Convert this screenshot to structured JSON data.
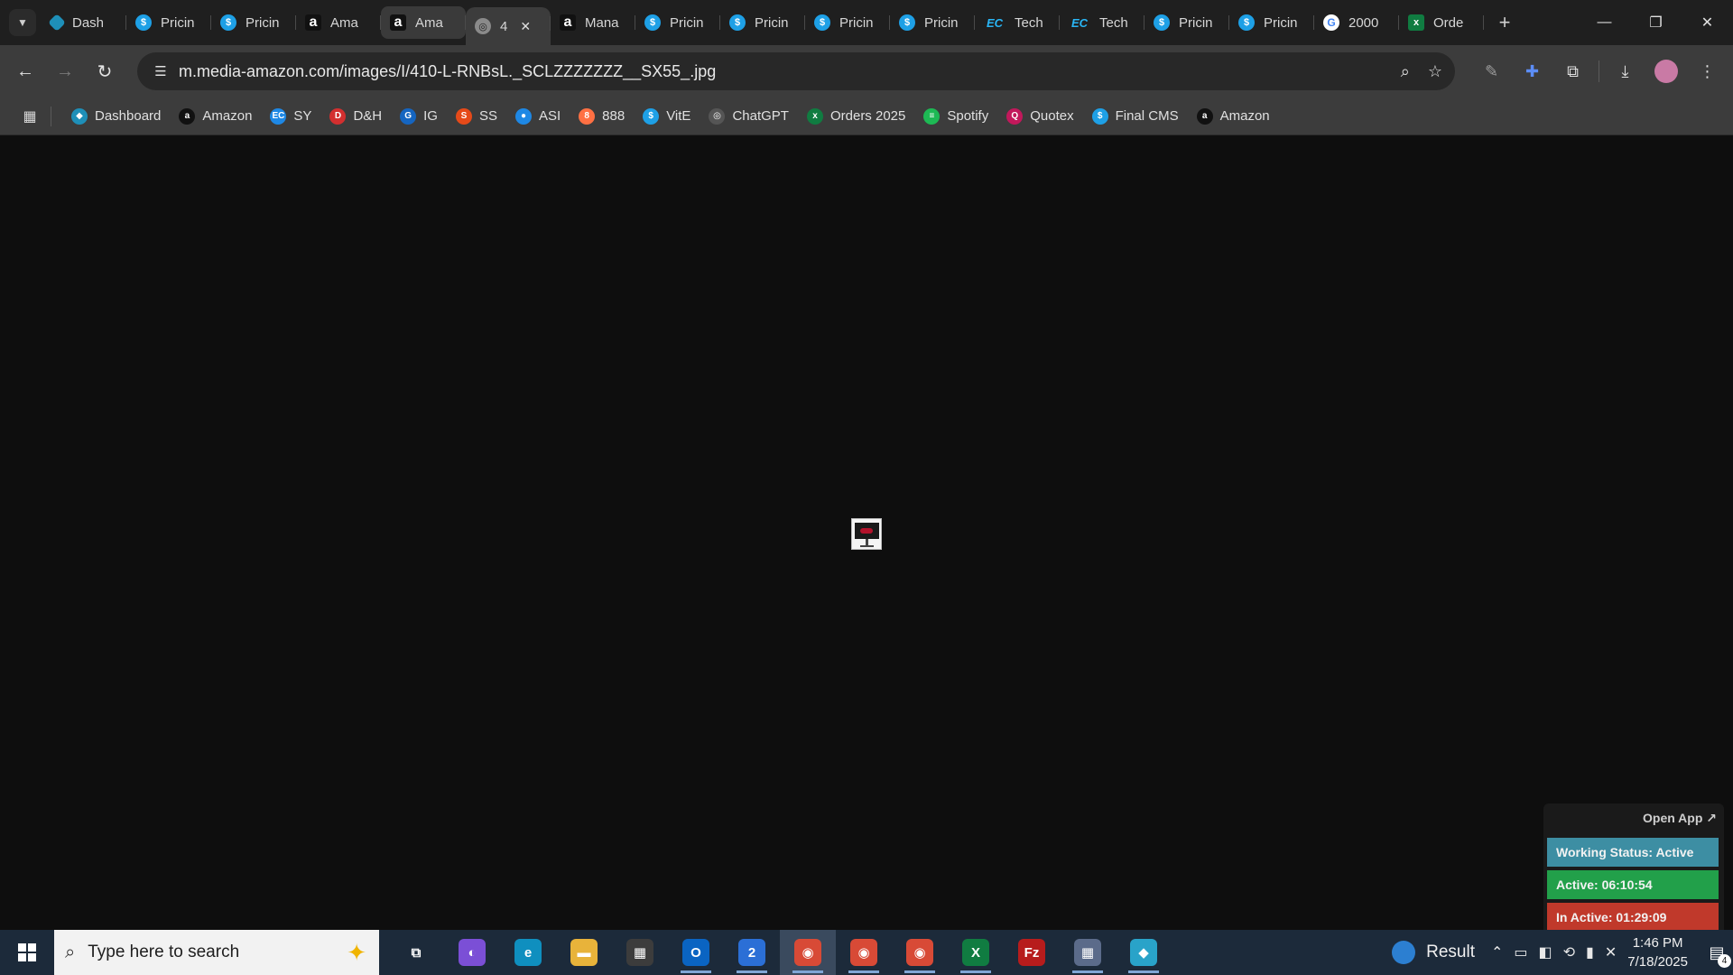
{
  "browser": {
    "tab_search_icon": "chevron-down-icon",
    "tabs": [
      {
        "label": "Dash",
        "icon": "dashboard-icon",
        "kind": "dash"
      },
      {
        "label": "Pricin",
        "icon": "dollar-icon",
        "kind": "dollar"
      },
      {
        "label": "Pricin",
        "icon": "dollar-icon",
        "kind": "dollar"
      },
      {
        "label": "Ama",
        "icon": "amazon-icon",
        "kind": "amazon"
      },
      {
        "label": "Ama",
        "icon": "amazon-icon",
        "kind": "amazon",
        "highlight": true
      },
      {
        "label": "4",
        "icon": "globe-icon",
        "kind": "globe",
        "active": true
      },
      {
        "label": "Mana",
        "icon": "amazon-icon",
        "kind": "amazon"
      },
      {
        "label": "Pricin",
        "icon": "dollar-icon",
        "kind": "dollar"
      },
      {
        "label": "Pricin",
        "icon": "dollar-icon",
        "kind": "dollar"
      },
      {
        "label": "Pricin",
        "icon": "dollar-icon",
        "kind": "dollar"
      },
      {
        "label": "Pricin",
        "icon": "dollar-icon",
        "kind": "dollar"
      },
      {
        "label": "Tech",
        "icon": "ec-icon",
        "kind": "ec"
      },
      {
        "label": "Tech",
        "icon": "ec-icon",
        "kind": "ec"
      },
      {
        "label": "Pricin",
        "icon": "dollar-icon",
        "kind": "dollar"
      },
      {
        "label": "Pricin",
        "icon": "dollar-icon",
        "kind": "dollar"
      },
      {
        "label": "2000",
        "icon": "google-icon",
        "kind": "google"
      },
      {
        "label": "Orde",
        "icon": "excel-icon",
        "kind": "excel"
      }
    ],
    "address": "m.media-amazon.com/images/I/410-L-RNBsL._SCLZZZZZZZ__SX55_.jpg"
  },
  "bookmarks": [
    {
      "label": "Dashboard",
      "color": "#1e8fb8",
      "glyph": "◆"
    },
    {
      "label": "Amazon",
      "color": "#111111",
      "glyph": "a"
    },
    {
      "label": "SY",
      "color": "#1e88e5",
      "glyph": "EC"
    },
    {
      "label": "D&H",
      "color": "#d32f2f",
      "glyph": "D"
    },
    {
      "label": "IG",
      "color": "#1565c0",
      "glyph": "G"
    },
    {
      "label": "SS",
      "color": "#e64a19",
      "glyph": "S"
    },
    {
      "label": "ASI",
      "color": "#1e88e5",
      "glyph": "●"
    },
    {
      "label": "888",
      "color": "#ff7043",
      "glyph": "8"
    },
    {
      "label": "VitE",
      "color": "#1ea0e6",
      "glyph": "$"
    },
    {
      "label": "ChatGPT",
      "color": "#555555",
      "glyph": "◎"
    },
    {
      "label": "Orders 2025",
      "color": "#107c41",
      "glyph": "x"
    },
    {
      "label": "Spotify",
      "color": "#1db954",
      "glyph": "≡"
    },
    {
      "label": "Quotex",
      "color": "#c2185b",
      "glyph": "Q"
    },
    {
      "label": "Final CMS",
      "color": "#1ea0e6",
      "glyph": "$"
    },
    {
      "label": "Amazon",
      "color": "#111111",
      "glyph": "a"
    }
  ],
  "widget": {
    "open_app": "Open App ↗",
    "working_status": "Working Status: Active",
    "active": "Active: 06:10:54",
    "inactive": "In Active: 01:29:09"
  },
  "taskbar": {
    "search_placeholder": "Type here to search",
    "apps": [
      {
        "name": "task-view-icon",
        "color": "transparent",
        "glyph": "⧉"
      },
      {
        "name": "copilot-icon",
        "color": "#7b4fd6",
        "glyph": "◐"
      },
      {
        "name": "edge-icon",
        "color": "#0f8fbf",
        "glyph": "e"
      },
      {
        "name": "file-explorer-icon",
        "color": "#e8b33a",
        "glyph": "▬"
      },
      {
        "name": "store-icon",
        "color": "#3c3c3c",
        "glyph": "▦"
      },
      {
        "name": "outlook-icon",
        "color": "#0a64c2",
        "glyph": "O"
      },
      {
        "name": "mail-icon",
        "color": "#2b6fd6",
        "glyph": "2"
      },
      {
        "name": "chrome-icon",
        "color": "#d84a36",
        "glyph": "◉"
      },
      {
        "name": "chrome-icon",
        "color": "#d84a36",
        "glyph": "◉"
      },
      {
        "name": "chrome-icon",
        "color": "#d84a36",
        "glyph": "◉"
      },
      {
        "name": "excel-icon",
        "color": "#107c41",
        "glyph": "X"
      },
      {
        "name": "filezilla-icon",
        "color": "#b71c1c",
        "glyph": "Fz"
      },
      {
        "name": "calculator-icon",
        "color": "#5b6b8a",
        "glyph": "▦"
      },
      {
        "name": "app-icon",
        "color": "#29a3c9",
        "glyph": "◆"
      }
    ],
    "weather": "Result",
    "time": "1:46 PM",
    "date": "7/18/2025",
    "notification_count": "4"
  }
}
